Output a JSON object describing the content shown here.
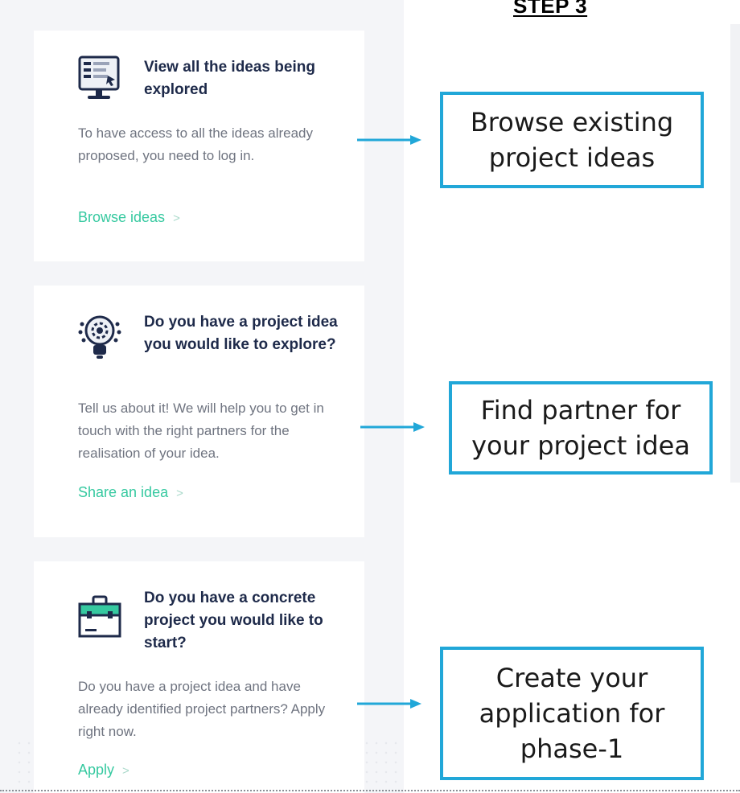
{
  "step_title": "STEP 3",
  "cards": [
    {
      "title": "View all the ideas being explored",
      "description": "To have access to all the ideas already proposed, you need to log in.",
      "link": "Browse ideas",
      "icon": "computer-screen-icon"
    },
    {
      "title": "Do you have a project idea you would like to explore?",
      "description": "Tell us about it! We will help you to get in touch with the right partners for the realisation of your idea.",
      "link": "Share an idea",
      "icon": "lightbulb-gear-icon"
    },
    {
      "title": "Do you have a concrete project you would like to start?",
      "description": "Do you have a project idea and have already identified project partners? Apply right now.",
      "link": "Apply",
      "icon": "toolbox-icon"
    }
  ],
  "link_chevron": ">",
  "callouts": [
    "Browse existing project ideas",
    "Find partner for your project idea",
    "Create your application for phase-1"
  ],
  "colors": {
    "accent_green": "#36c9a0",
    "callout_border": "#21a7d8",
    "title_navy": "#1e2a4a"
  }
}
